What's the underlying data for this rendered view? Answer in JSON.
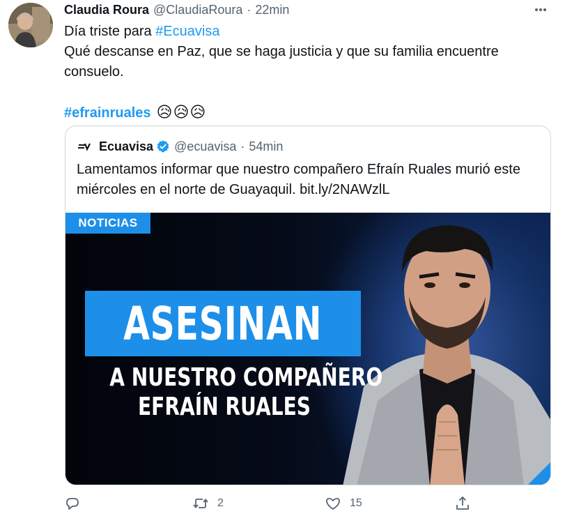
{
  "tweet": {
    "author_name": "Claudia Roura",
    "author_handle": "@ClaudiaRoura",
    "separator": "·",
    "time": "22min",
    "lines": [
      "Qué descanse en Paz, que se haga justicia y que su familia encuentre",
      "consuelo."
    ],
    "line1_prefix": "Día triste para ",
    "line1_hashtag": "#Ecuavisa",
    "hashtag2": "#efrainruales",
    "emojis": "😥😥😥"
  },
  "quote": {
    "author_name": "Ecuavisa",
    "author_handle": "@ecuavisa",
    "separator": "·",
    "time": "54min",
    "lines": [
      "Lamentamos informar que nuestro compañero Efraín Ruales murió este",
      "miércoles en el norte de Guayaquil. bit.ly/2NAWzlL"
    ],
    "media": {
      "badge": "NOTICIAS",
      "headline": "ASESINAN",
      "sub1": "A NUESTRO COMPAÑERO",
      "sub2": "EFRAÍN RUALES"
    }
  },
  "actions": {
    "reply_icon": "reply-icon",
    "retweet_icon": "retweet-icon",
    "retweet_count": "2",
    "like_icon": "heart-icon",
    "like_count": "15",
    "share_icon": "share-icon"
  },
  "colors": {
    "accent": "#1d9bf0",
    "muted": "#536471",
    "border": "#cfd9de",
    "banner_blue": "#1d8fe8"
  }
}
